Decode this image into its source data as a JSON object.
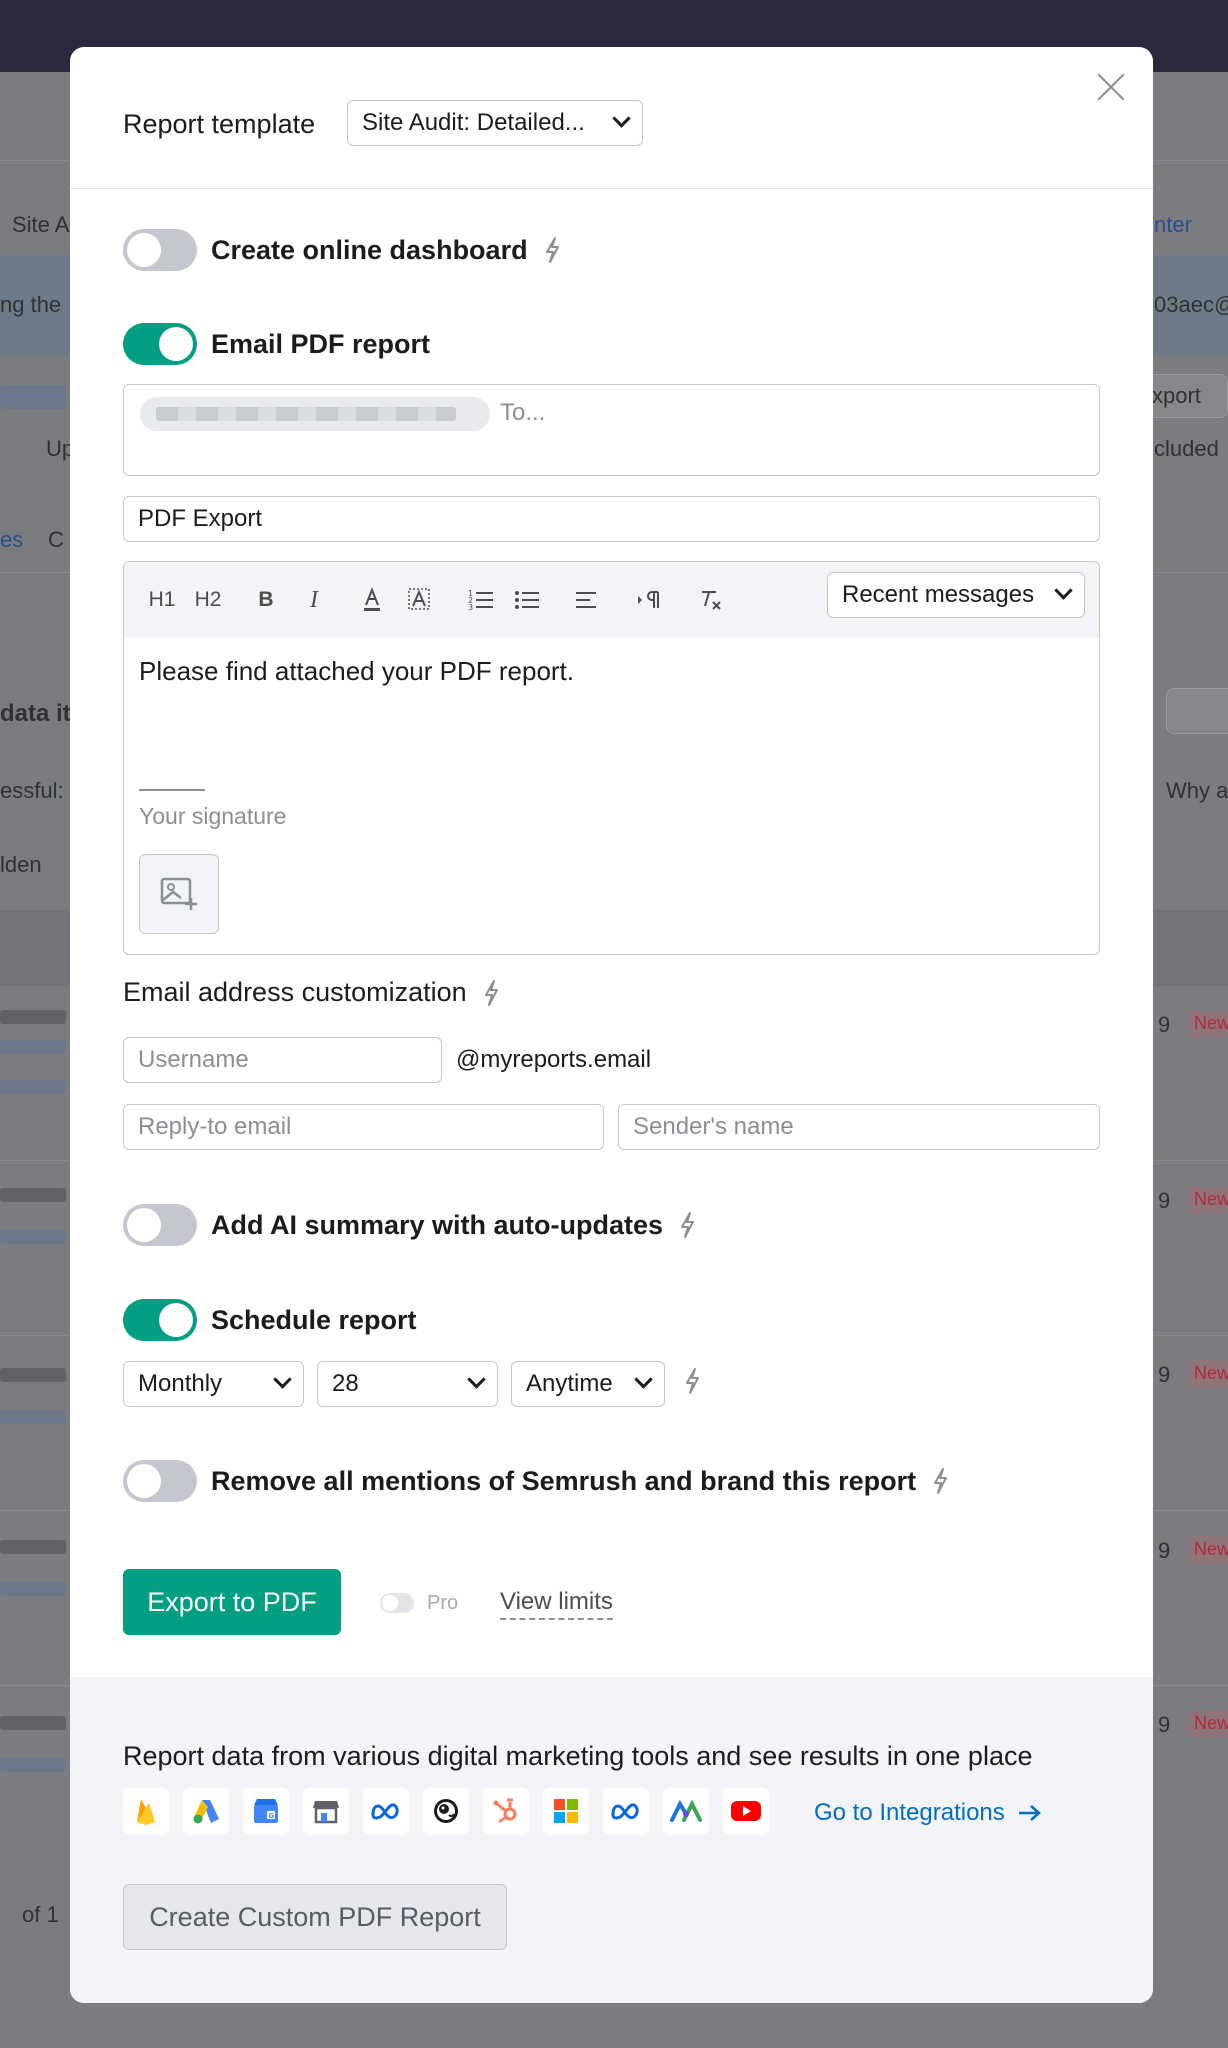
{
  "background": {
    "tab_site": "Site A",
    "link_center": "nter",
    "banner_left": "ng the",
    "banner_right": "03aec@",
    "export_btn": "xport",
    "up_text": "Up",
    "included_text": "cluded",
    "tabs_text": "es",
    "tabs_text_c": "C",
    "data_text": "data it",
    "success_text": "essful:",
    "why_text": "Why a",
    "hidden_text": "lden",
    "row_numbers": [
      "9",
      "9",
      "9",
      "9",
      "9"
    ],
    "badge": "New",
    "pagination": "of 1"
  },
  "modal": {
    "report_template_label": "Report template",
    "report_template_value": "Site Audit: Detailed...",
    "create_dashboard_label": "Create online dashboard",
    "email_pdf_label": "Email PDF report",
    "to_placeholder": "To...",
    "subject_value": "PDF Export",
    "toolbar": {
      "h1": "H1",
      "h2": "H2",
      "bold": "B",
      "italic": "I",
      "recent_messages": "Recent messages"
    },
    "message_body": "Please find attached your PDF report.",
    "signature_placeholder": "Your signature",
    "email_customization_label": "Email address customization",
    "username_placeholder": "Username",
    "domain_suffix": "@myreports.email",
    "reply_to_placeholder": "Reply-to email",
    "sender_name_placeholder": "Sender's name",
    "ai_summary_label": "Add AI summary with auto-updates",
    "schedule_label": "Schedule report",
    "schedule_frequency": "Monthly",
    "schedule_day": "28",
    "schedule_time": "Anytime",
    "branding_label": "Remove all mentions of Semrush and brand this report",
    "export_button": "Export to PDF",
    "pro_label": "Pro",
    "view_limits": "View limits",
    "footer_text": "Report data from various digital marketing tools and see results in one place",
    "go_integrations": "Go to Integrations",
    "custom_report_button": "Create Custom PDF Report"
  },
  "toggles": {
    "create_dashboard": false,
    "email_pdf": true,
    "ai_summary": false,
    "schedule": true,
    "branding": false,
    "pro": false
  },
  "colors": {
    "accent": "#009f81",
    "link": "#006dca",
    "toggle_off": "#c4c7cf"
  },
  "integrations": [
    "firebase-icon",
    "google-ads-icon",
    "google-business-profile-icon",
    "store-icon",
    "meta-icon",
    "mailchimp-icon",
    "hubspot-icon",
    "microsoft-ads-icon",
    "meta-ads-icon",
    "analytics-icon",
    "youtube-icon"
  ]
}
